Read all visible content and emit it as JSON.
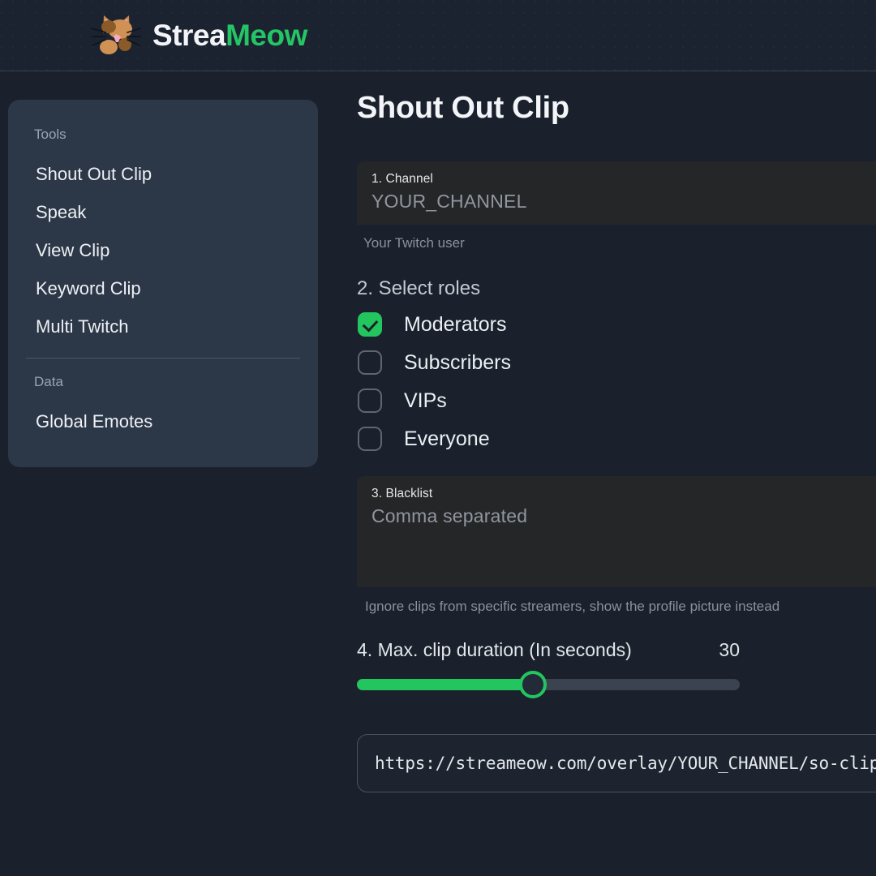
{
  "brand": {
    "name_part_1": "Strea",
    "name_part_2": "Meow",
    "accent_color": "#25c566",
    "logo_icon": "cat-face-icon"
  },
  "sidebar": {
    "sections": [
      {
        "title": "Tools",
        "items": [
          {
            "label": "Shout Out Clip"
          },
          {
            "label": "Speak"
          },
          {
            "label": "View Clip"
          },
          {
            "label": "Keyword Clip"
          },
          {
            "label": "Multi Twitch"
          }
        ]
      },
      {
        "title": "Data",
        "items": [
          {
            "label": "Global Emotes"
          }
        ]
      }
    ]
  },
  "main": {
    "title": "Shout Out Clip",
    "channel": {
      "label": "1. Channel",
      "placeholder": "YOUR_CHANNEL",
      "value": "",
      "helper": "Your Twitch user"
    },
    "roles": {
      "heading": "2. Select roles",
      "options": [
        {
          "label": "Moderators",
          "checked": true
        },
        {
          "label": "Subscribers",
          "checked": false
        },
        {
          "label": "VIPs",
          "checked": false
        },
        {
          "label": "Everyone",
          "checked": false
        }
      ]
    },
    "blacklist": {
      "label": "3. Blacklist",
      "placeholder": "Comma separated",
      "value": "",
      "helper": "Ignore clips from specific streamers, show the profile picture instead"
    },
    "duration": {
      "label": "4. Max. clip duration (In seconds)",
      "value": "30",
      "min": 0,
      "max": 65,
      "fill_percent": 46,
      "accent_color": "#22c55e"
    },
    "overlay_url": {
      "value": "https://streameow.com/overlay/YOUR_CHANNEL/so-clip"
    }
  },
  "theme": {
    "page_background": "#1a212c",
    "header_background": "#1b2230",
    "sidebar_background": "#2c3748",
    "field_background": "#252628",
    "accent_green": "#22c55e"
  }
}
